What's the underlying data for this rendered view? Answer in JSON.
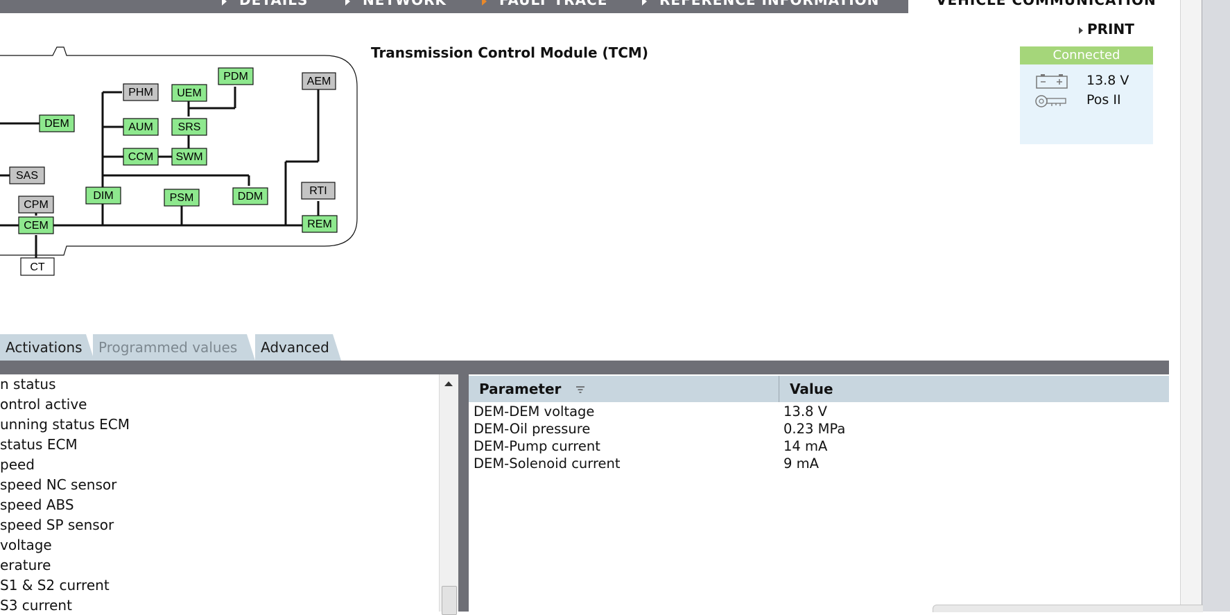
{
  "nav": {
    "items": [
      {
        "label": "DETAILS",
        "active": false
      },
      {
        "label": "NETWORK",
        "active": false
      },
      {
        "label": "FAULT TRACE",
        "active": true
      },
      {
        "label": "REFERENCE INFORMATION",
        "active": false
      }
    ],
    "vehicle_communication": "VEHICLE COMMUNICATION"
  },
  "print_label": "PRINT",
  "connection": {
    "status": "Connected",
    "voltage": "13.8 V",
    "key_position": "Pos II",
    "status_color": "#a5d67a",
    "panel_color": "#e7f3fb"
  },
  "module_title": "Transmission Control Module (TCM)",
  "diagram": {
    "green_color": "#8ee88e",
    "gray_color": "#c4c4c4",
    "nodes": [
      "PHM",
      "UEM",
      "PDM",
      "AEM",
      "DEM",
      "AUM",
      "SRS",
      "CCM",
      "SWM",
      "SAS",
      "DIM",
      "PSM",
      "DDM",
      "RTI",
      "CPM",
      "CEM",
      "REM",
      "CT"
    ]
  },
  "tabs": [
    {
      "label": "Activations"
    },
    {
      "label": "Programmed values"
    },
    {
      "label": "Advanced"
    }
  ],
  "left_list": [
    "n status",
    "ontrol active",
    "unning status ECM",
    "status ECM",
    "peed",
    "speed NC sensor",
    "speed ABS",
    "speed SP sensor",
    "voltage",
    "erature",
    " S1 & S2 current",
    " S3 current"
  ],
  "table": {
    "headers": {
      "parameter": "Parameter",
      "value": "Value"
    },
    "rows": [
      {
        "parameter": "DEM-DEM voltage",
        "value": "13.8 V"
      },
      {
        "parameter": "DEM-Oil pressure",
        "value": "0.23 MPa"
      },
      {
        "parameter": "DEM-Pump current",
        "value": "14 mA"
      },
      {
        "parameter": "DEM-Solenoid current",
        "value": "9 mA"
      }
    ]
  }
}
